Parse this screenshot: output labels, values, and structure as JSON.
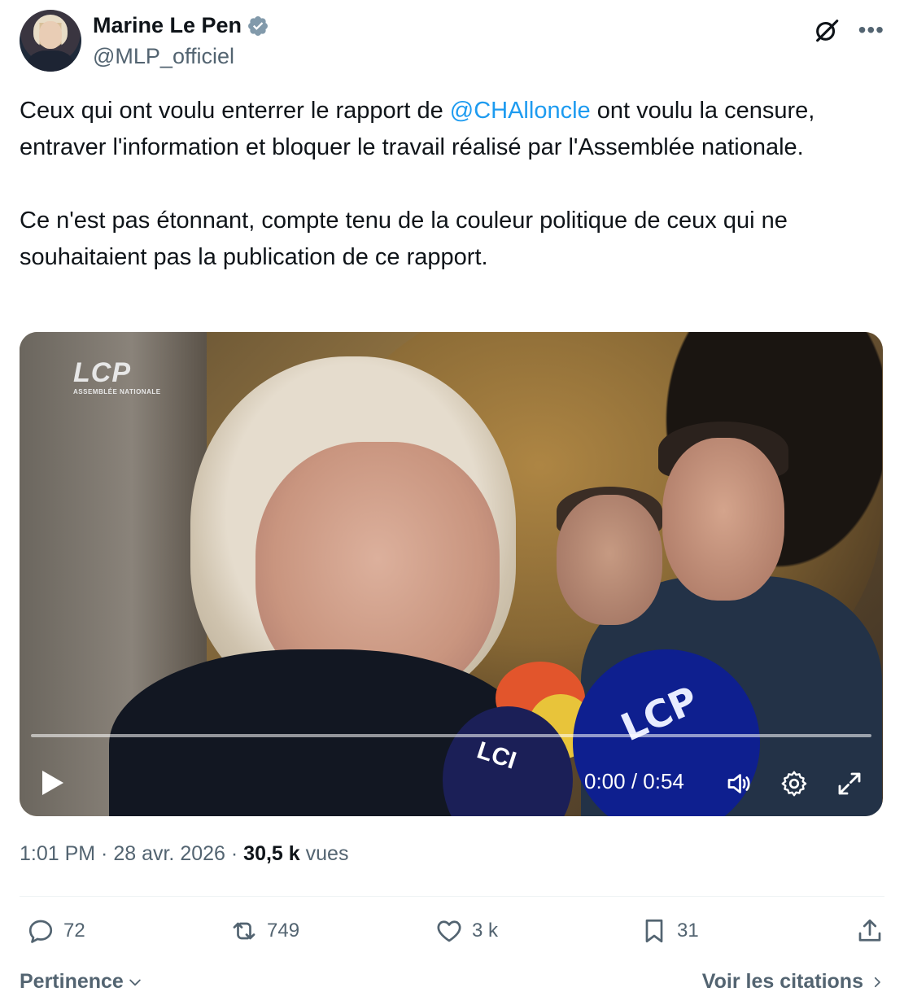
{
  "author": {
    "name": "Marine Le Pen",
    "handle": "@MLP_officiel",
    "verified_icon": "verified-badge-icon",
    "verified_color": "#829aab"
  },
  "tweet": {
    "para1_before": "Ceux qui ont voulu enterrer le rapport de ",
    "mention": "@CHAlloncle",
    "para1_after": " ont voulu la censure, entraver l'information et bloquer le travail réalisé par l'Assemblée nationale.",
    "para2": "Ce n'est pas étonnant, compte tenu de la couleur politique de ceux qui ne souhaitaient pas la publication de ce rapport."
  },
  "video": {
    "channel_logo": "LCP",
    "channel_sub": "ASSEMBLÉE NATIONALE",
    "mic_blue_text": "LCP",
    "mic_dark_text": "LCI",
    "time": "0:00 / 0:54",
    "progress": 0
  },
  "meta": {
    "time": "1:01 PM",
    "sep1": " · ",
    "date": "28 avr. 2026",
    "sep2": " · ",
    "views_count": "30,5 k",
    "views_label": " vues"
  },
  "actions": {
    "replies": "72",
    "reposts": "749",
    "likes": "3 k",
    "bookmarks": "31"
  },
  "footer": {
    "sort_label": "Pertinence",
    "quotes_label": "Voir les citations"
  },
  "colors": {
    "mention": "#1d9bf0",
    "secondary_text": "#536471",
    "primary_text": "#0f1419"
  }
}
